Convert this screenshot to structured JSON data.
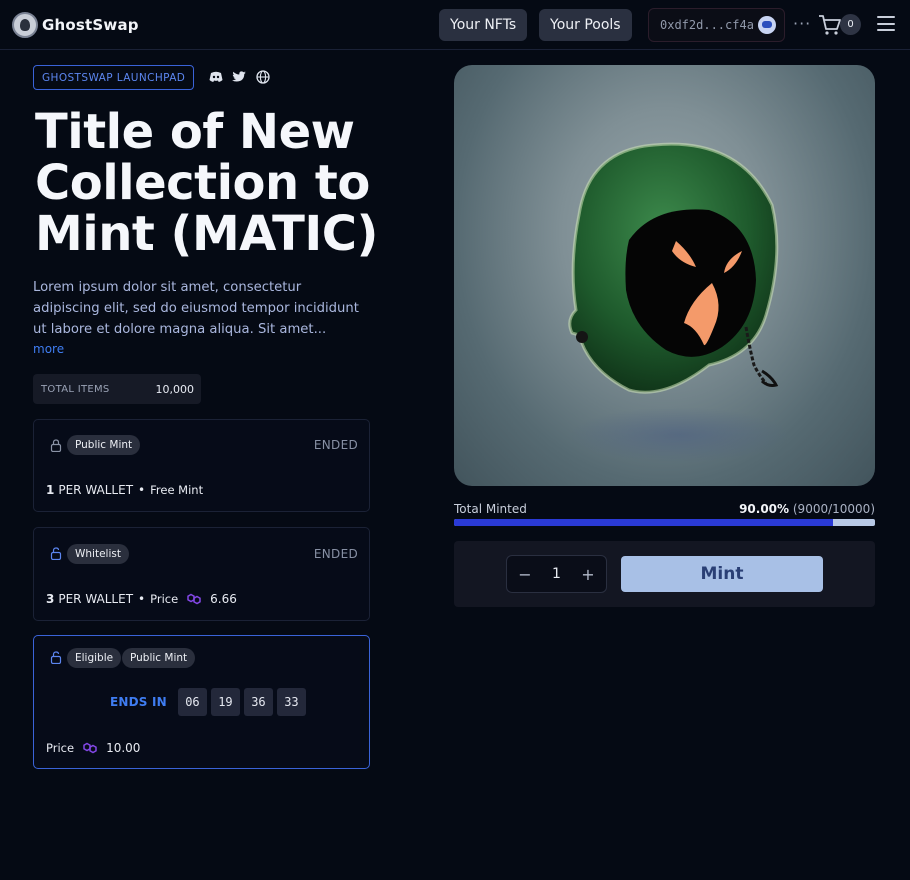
{
  "header": {
    "logo_text": "GhostSwap",
    "nav": [
      "Your NFTs",
      "Your Pools"
    ],
    "wallet_address": "0xdf2d...cf4a",
    "more_label": "···",
    "cart_count": "0"
  },
  "collection": {
    "badge": "GHOSTSWAP LAUNCHPAD",
    "socials": [
      "discord-icon",
      "twitter-icon",
      "globe-icon"
    ],
    "title": "Title of New Collection to Mint (MATIC)",
    "description": "Lorem ipsum dolor sit amet, consectetur adipiscing elit, sed do eiusmod tempor incididunt ut labore et dolore magna aliqua. Sit amet...",
    "more": "more",
    "total_items_label": "TOTAL ITEMS",
    "total_items_value": "10,000"
  },
  "phases": [
    {
      "pill": "Public Mint",
      "status": "ENDED",
      "qty": "1",
      "per_wallet": "PER WALLET",
      "separator": "•",
      "price_text": "Free Mint"
    },
    {
      "pill": "Whitelist",
      "status": "ENDED",
      "qty": "3",
      "per_wallet": "PER WALLET",
      "separator": "•",
      "price_label": "Price",
      "price_value": "6.66"
    },
    {
      "pills": [
        "Eligible",
        "Public Mint"
      ],
      "ends_in": "ENDS IN",
      "countdown": [
        "06",
        "19",
        "36",
        "33"
      ],
      "price_label": "Price",
      "price_value": "10.00"
    }
  ],
  "mint": {
    "total_minted_label": "Total Minted",
    "percent": "90.00%",
    "count": "(9000/10000)",
    "progress_fraction": 0.9,
    "quantity": "1",
    "minus": "−",
    "plus": "+",
    "button": "Mint"
  },
  "colors": {
    "accent": "#3f7df2",
    "progress": "#2a3ad6",
    "mint_button": "#a8c0e6",
    "matic": "#8247e5"
  }
}
